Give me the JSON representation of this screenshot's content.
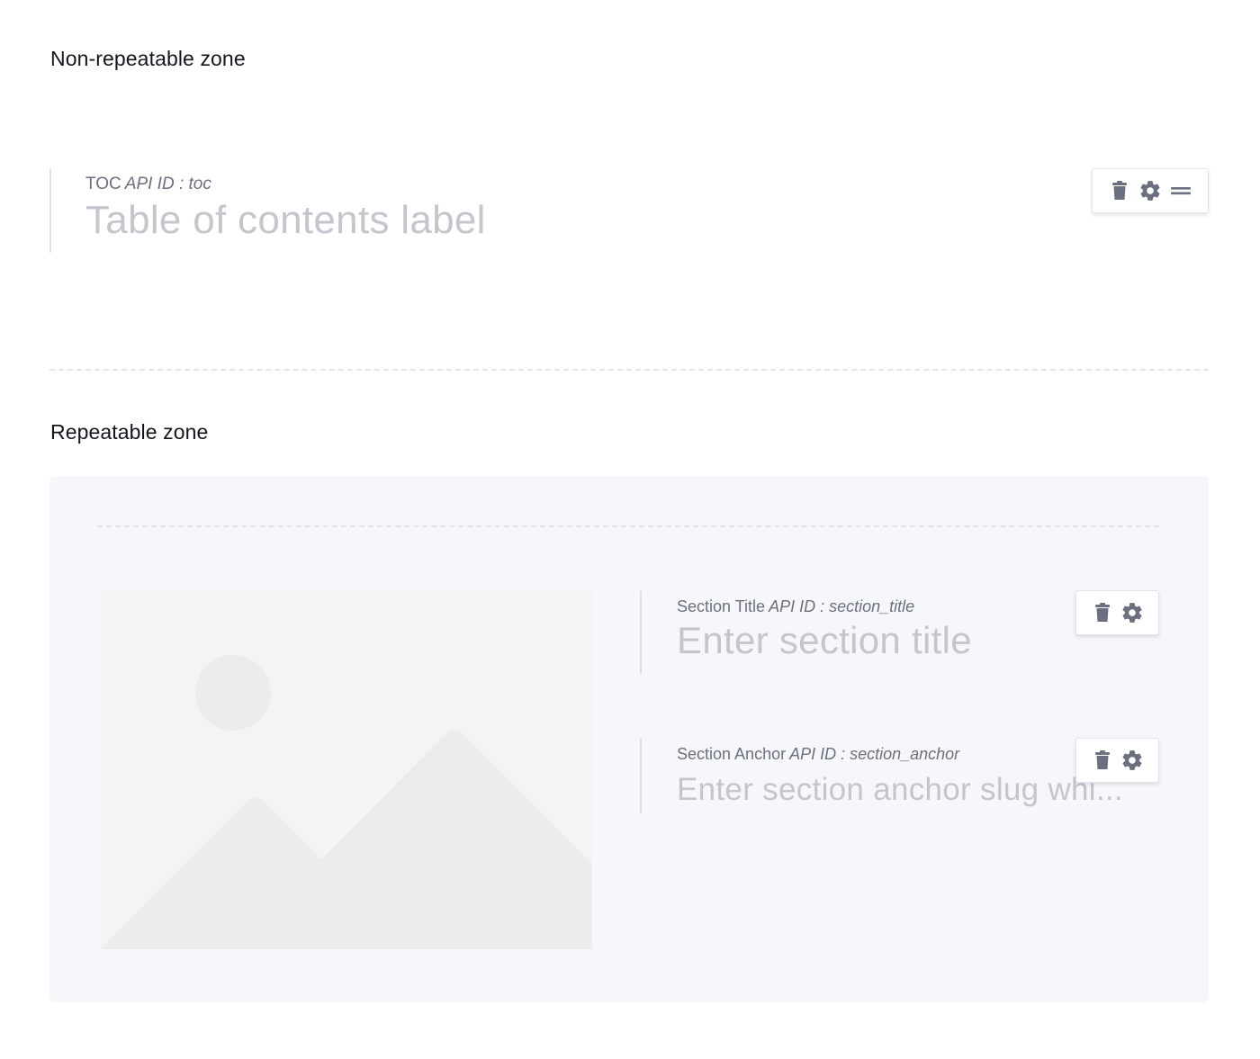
{
  "non_repeatable_zone": {
    "heading": "Non-repeatable zone",
    "fields": [
      {
        "label": "TOC",
        "api_id": "API ID : toc",
        "placeholder": "Table of contents label",
        "toolbar": [
          "trash-icon",
          "gear-icon",
          "drag-handle-icon"
        ]
      }
    ]
  },
  "repeatable_zone": {
    "heading": "Repeatable zone",
    "fields": [
      {
        "label": "Section Title",
        "api_id": "API ID : section_title",
        "placeholder": "Enter section title",
        "toolbar": [
          "trash-icon",
          "gear-icon"
        ]
      },
      {
        "label": "Section Anchor",
        "api_id": "API ID : section_anchor",
        "placeholder": "Enter section anchor slug whi...",
        "toolbar": [
          "trash-icon",
          "gear-icon"
        ]
      }
    ],
    "image_placeholder_icon": "image-placeholder-icon"
  },
  "colors": {
    "panel_background": "#f6f7fa",
    "placeholder_text": "#c3c6cd",
    "meta_text": "#6b7080",
    "icon": "#6b7080",
    "image_shape": "#ececec"
  }
}
